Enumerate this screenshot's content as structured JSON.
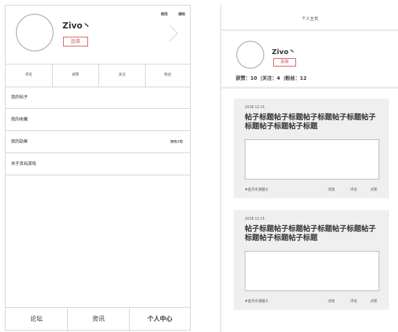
{
  "left": {
    "header": {
      "edit_label": "修改",
      "notify_label": "通知",
      "username": "Zivo丶",
      "badge_label": "勋章"
    },
    "stats": [
      "评论",
      "获赞",
      "关注",
      "粉丝"
    ],
    "menu": [
      {
        "label": "我的帖子",
        "extra": ""
      },
      {
        "label": "我的收藏",
        "extra": ""
      },
      {
        "label": "我的勋章",
        "extra": "拥有X枚"
      },
      {
        "label": "关于贪玩游戏",
        "extra": ""
      }
    ],
    "tabs": [
      "论坛",
      "资讯",
      "个人中心"
    ]
  },
  "right": {
    "page_title": "个人主页",
    "username": "Zivo丶",
    "badge_label": "勋章",
    "stats_line": "获赞：10  |关注：4  |粉丝：12",
    "posts": [
      {
        "date": "2018.12.15",
        "title": "帖子标题帖子标题帖子标题帖子标题帖子标题帖子标题帖子标题",
        "tag": "#蓝月手游圈子",
        "views": "浏览",
        "comments": "评论",
        "likes": "点赞"
      },
      {
        "date": "2018.12.15",
        "title": "帖子标题帖子标题帖子标题帖子标题帖子标题帖子标题帖子标题",
        "tag": "#蓝月手游圈子",
        "views": "浏览",
        "comments": "评论",
        "likes": "点赞"
      }
    ]
  },
  "colors": {
    "badge_red": "#d45a5a",
    "card_bg": "#efefef",
    "border": "#d3d3d3"
  }
}
